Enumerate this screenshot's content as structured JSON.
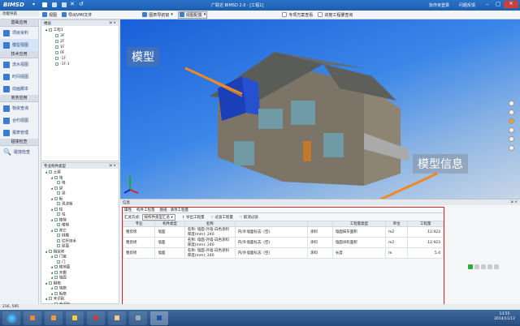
{
  "app": {
    "logo": "BIMSD",
    "title": "广联达 BIMSD 2.0 - [工程1]",
    "cloud": "协作未登录",
    "help": "问题反馈"
  },
  "toolbar": {
    "items": [
      "视图",
      "导出VMI文件",
      "图表导航窗",
      "视图配置",
      "专项方案查看",
      "进度工程量查询"
    ]
  },
  "sidebar": {
    "header": "功能导航",
    "sections": [
      {
        "title": "基础应用",
        "items": [
          "项目资料",
          "模型视图"
        ]
      },
      {
        "title": "技术应用",
        "items": [
          "流水视图",
          "时间视图",
          "动画脚本"
        ]
      },
      {
        "title": "商务应用",
        "items": [
          "物资查询",
          "合约视图",
          "报表管理"
        ]
      },
      {
        "title": "碰撞检查",
        "items": [
          "碰撞检查"
        ]
      }
    ]
  },
  "floor_panel": {
    "title": "楼层",
    "items": [
      "工程1",
      "3F",
      "2F",
      "1F",
      "0F",
      "-1F",
      "-1F-1"
    ]
  },
  "component_panel": {
    "title": "专业构件类型",
    "items": [
      {
        "label": "土建",
        "level": 0
      },
      {
        "label": "墙",
        "level": 1
      },
      {
        "label": "墙",
        "level": 2
      },
      {
        "label": "梁",
        "level": 1
      },
      {
        "label": "梁",
        "level": 2
      },
      {
        "label": "板",
        "level": 1
      },
      {
        "label": "现浇板",
        "level": 2
      },
      {
        "label": "柱",
        "level": 1
      },
      {
        "label": "柱",
        "level": 2
      },
      {
        "label": "楼梯",
        "level": 1
      },
      {
        "label": "楼梯",
        "level": 2
      },
      {
        "label": "其它",
        "level": 1
      },
      {
        "label": "挑檐",
        "level": 2
      },
      {
        "label": "栏杆扶手",
        "level": 2
      },
      {
        "label": "屋面",
        "level": 2
      },
      {
        "label": "粗装修",
        "level": 0
      },
      {
        "label": "门窗",
        "level": 1
      },
      {
        "label": "门",
        "level": 2
      },
      {
        "label": "楼地面",
        "level": 1
      },
      {
        "label": "天棚",
        "level": 1
      },
      {
        "label": "墙面",
        "level": 1
      },
      {
        "label": "钢筋",
        "level": 0
      },
      {
        "label": "墙筋",
        "level": 1
      },
      {
        "label": "板筋",
        "level": 1
      },
      {
        "label": "未识别",
        "level": 0
      },
      {
        "label": "未识别",
        "level": 1
      }
    ]
  },
  "view": {
    "callout_model": "模型",
    "callout_info": "模型信息"
  },
  "info": {
    "title": "信息",
    "tabs": [
      "属性",
      "构件工程量",
      "图纸",
      "清单工程量"
    ],
    "mode_label": "汇总方式:",
    "mode_value": "按构件类型汇总",
    "btn_export": "导出工程量",
    "btn_filter": "过滤工程量",
    "btn_clear": "取消过滤",
    "columns": [
      "专业",
      "构件类型",
      "名称",
      "",
      "",
      "工程量类型",
      "单位",
      "工程量"
    ],
    "rows": [
      {
        "major": "粗装修",
        "type": "墙面",
        "name": "名称: 墙面-外墙-白色涂料 厚度(mm): 240",
        "spec": "内/外墙面标志: (空)",
        "mat": "涂料",
        "qtype": "墙面抹灰面积",
        "unit": "m2",
        "qty": "12.923"
      },
      {
        "major": "粗装修",
        "type": "墙面",
        "name": "名称: 墙面-外墙-白色涂料 厚度(mm): 240",
        "spec": "内/外墙面标志: (空)",
        "mat": "涂料",
        "qtype": "墙面块料面积",
        "unit": "m2",
        "qty": "12.923"
      },
      {
        "major": "粗装修",
        "type": "墙面",
        "name": "名称: 墙面-外墙-白色涂料 厚度(mm): 240",
        "spec": "内/外墙面标志: (空)",
        "mat": "涂料",
        "qtype": "长度",
        "unit": "m",
        "qty": "5.4"
      }
    ]
  },
  "status": {
    "coords": "216, 595"
  },
  "taskbar": {
    "time": "13:55",
    "date": "2014/11/12"
  },
  "colors": {
    "title": "#1d5fb0",
    "highlight": "#e02020",
    "callout_arrow": "#f08a20"
  }
}
